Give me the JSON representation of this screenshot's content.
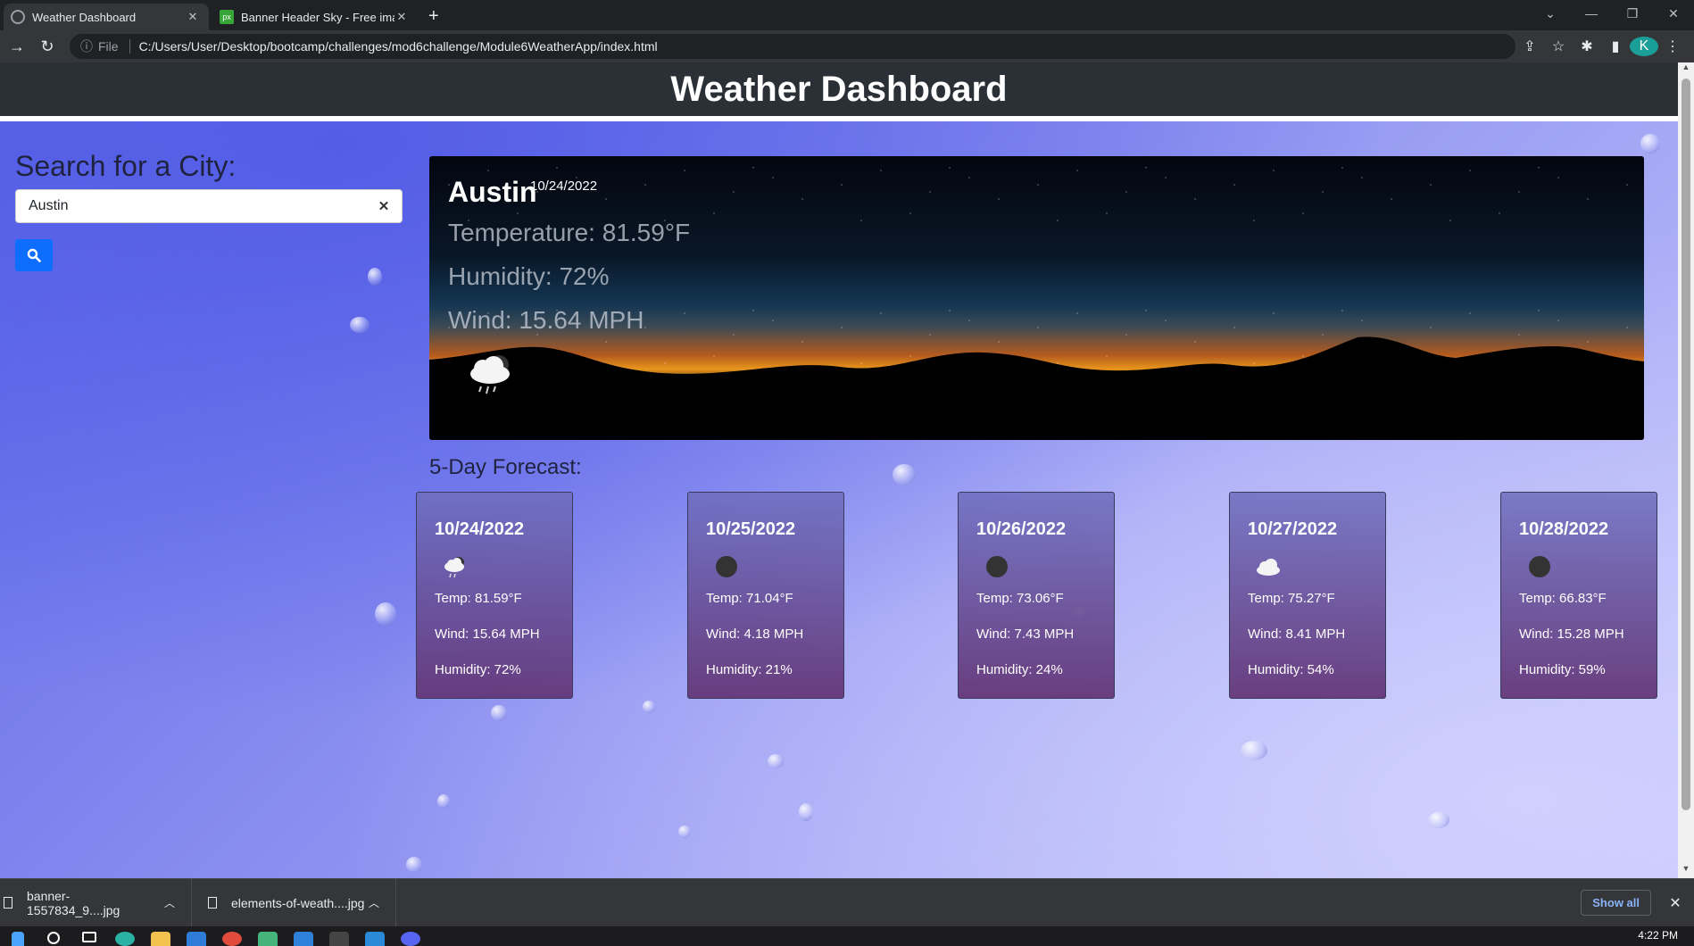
{
  "browser": {
    "tabs": [
      {
        "title": "Weather Dashboard",
        "active": true,
        "favicon_color": "#9aa0a6"
      },
      {
        "title": "Banner Header Sky - Free image",
        "active": false,
        "favicon_color": "#38a538"
      }
    ],
    "address": {
      "scheme_label": "File",
      "url": "C:/Users/User/Desktop/bootcamp/challenges/mod6challenge/Module6WeatherApp/index.html"
    },
    "profile_initial": "K"
  },
  "page": {
    "title": "Weather Dashboard",
    "search": {
      "heading": "Search for a City:",
      "value": "Austin",
      "clear_glyph": "✕"
    },
    "current": {
      "city": "Austin",
      "date": "10/24/2022",
      "temperature": "Temperature: 81.59°F",
      "humidity": "Humidity: 72%",
      "wind": "Wind: 15.64 MPH",
      "icon": "rain-cloud-night-icon"
    },
    "forecast_heading": "5-Day Forecast:",
    "forecast": [
      {
        "date": "10/24/2022",
        "temp": "Temp: 81.59°F",
        "wind": "Wind: 15.64 MPH",
        "humidity": "Humidity: 72%",
        "icon": "rain-cloud-icon"
      },
      {
        "date": "10/25/2022",
        "temp": "Temp: 71.04°F",
        "wind": "Wind: 4.18 MPH",
        "humidity": "Humidity: 21%",
        "icon": "clear-night-icon"
      },
      {
        "date": "10/26/2022",
        "temp": "Temp: 73.06°F",
        "wind": "Wind: 7.43 MPH",
        "humidity": "Humidity: 24%",
        "icon": "clear-night-icon"
      },
      {
        "date": "10/27/2022",
        "temp": "Temp: 75.27°F",
        "wind": "Wind: 8.41 MPH",
        "humidity": "Humidity: 54%",
        "icon": "cloud-icon"
      },
      {
        "date": "10/28/2022",
        "temp": "Temp: 66.83°F",
        "wind": "Wind: 15.28 MPH",
        "humidity": "Humidity: 59%",
        "icon": "clear-night-icon"
      }
    ]
  },
  "downloads": {
    "items": [
      {
        "name": "banner-1557834_9....jpg"
      },
      {
        "name": "elements-of-weath....jpg"
      }
    ],
    "show_all": "Show all"
  },
  "taskbar": {
    "time": "4:22 PM"
  },
  "colors": {
    "header_bg": "#2b2f36",
    "search_button": "#0d6efd",
    "forecast_card_top": "#6e6ebe",
    "forecast_card_bottom": "#643778"
  }
}
